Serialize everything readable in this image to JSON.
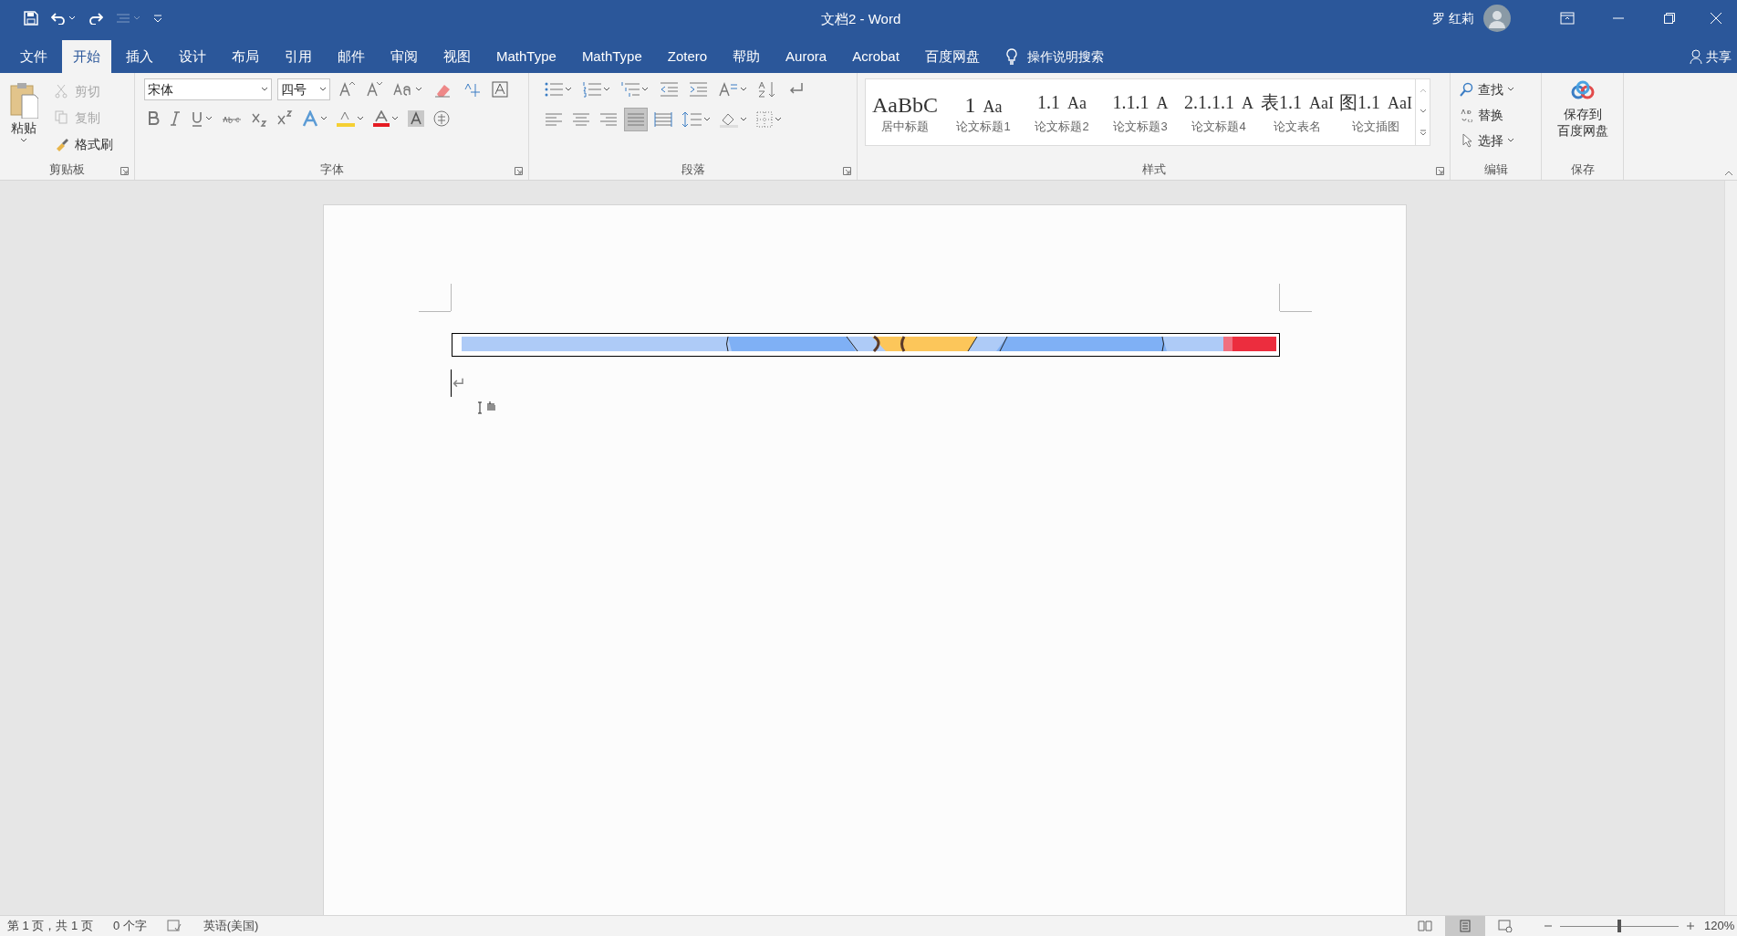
{
  "window": {
    "title": "文档2  -  Word",
    "user": "罗 红莉"
  },
  "tabs": [
    {
      "label": "文件",
      "selected": false
    },
    {
      "label": "开始",
      "selected": true
    },
    {
      "label": "插入",
      "selected": false
    },
    {
      "label": "设计",
      "selected": false
    },
    {
      "label": "布局",
      "selected": false
    },
    {
      "label": "引用",
      "selected": false
    },
    {
      "label": "邮件",
      "selected": false
    },
    {
      "label": "审阅",
      "selected": false
    },
    {
      "label": "视图",
      "selected": false
    },
    {
      "label": "MathType",
      "selected": false
    },
    {
      "label": "MathType",
      "selected": false
    },
    {
      "label": "Zotero",
      "selected": false
    },
    {
      "label": "帮助",
      "selected": false
    },
    {
      "label": "Aurora",
      "selected": false
    },
    {
      "label": "Acrobat",
      "selected": false
    },
    {
      "label": "百度网盘",
      "selected": false
    }
  ],
  "tell_me": "操作说明搜索",
  "share": "共享",
  "clipboard": {
    "label": "剪贴板",
    "paste": "粘贴",
    "items": [
      {
        "label": "剪切",
        "disabled": true
      },
      {
        "label": "复制",
        "disabled": true
      },
      {
        "label": "格式刷",
        "disabled": false
      }
    ]
  },
  "font": {
    "label": "字体",
    "font_name": "宋体",
    "font_size": "四号"
  },
  "paragraph": {
    "label": "段落",
    "alignment_buttons": [
      {
        "selected": false
      },
      {
        "selected": false
      },
      {
        "selected": false
      },
      {
        "selected": true
      },
      {
        "selected": false
      }
    ]
  },
  "styles": {
    "label": "样式",
    "items": [
      {
        "sample": "AaBbC",
        "name": "居中标题"
      },
      {
        "sample": "1",
        "tail": "Aa",
        "name": "论文标题1"
      },
      {
        "sample": "1.1",
        "tail": "Aa",
        "name": "论文标题2"
      },
      {
        "sample": "1.1.1",
        "tail": "A",
        "name": "论文标题3"
      },
      {
        "sample": "2.1.1.1",
        "tail": "A",
        "name": "论文标题4"
      },
      {
        "sample": "表1.1",
        "tail": "AaI",
        "name": "论文表名"
      },
      {
        "sample": "图1.1",
        "tail": "AaI",
        "name": "论文插图"
      }
    ]
  },
  "editing": {
    "label": "编辑",
    "items": [
      "查找",
      "替换",
      "选择"
    ]
  },
  "save_group": {
    "label": "保存",
    "button": [
      "保存到",
      "百度网盘"
    ]
  },
  "document": {
    "paragraph_mark": "↵"
  },
  "status_bar": {
    "page": "第 1 页，共 1 页",
    "words": "0 个字",
    "language": "英语(美国)",
    "views": [
      {
        "selected": false
      },
      {
        "selected": true
      },
      {
        "selected": false
      }
    ],
    "zoom": {
      "level": 0.5,
      "reading": "120%"
    }
  }
}
